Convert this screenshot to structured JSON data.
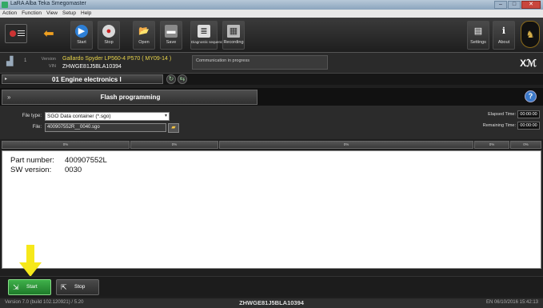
{
  "window": {
    "title": "LaRA  Alba Teka  Smegomaster"
  },
  "menu": [
    "Action",
    "Function",
    "View",
    "Setup",
    "Help"
  ],
  "toolbar": {
    "start": "Start",
    "stop": "Stop",
    "open": "Open",
    "save": "Save",
    "diagnostic": "Diagnostic sequences",
    "recording": "Recording",
    "settings": "Settings",
    "about": "About"
  },
  "vehicle": {
    "index": "1",
    "version_label": "Version",
    "vin_label": "VIN",
    "model": "Gallardo Spyder LP560-4 P570 ( MY09-14 )",
    "vin": "ZHWGE81J5BLA10394",
    "communication": "Communication in progress"
  },
  "module": {
    "name": "01 Engine electronics I"
  },
  "section": {
    "title": "Flash programming"
  },
  "file": {
    "type_label": "File type:",
    "type_value": "SGO Data container (*.sgo)",
    "file_label": "File:",
    "file_value": "400907552R__0040.sgo",
    "elapsed_label": "Elapsed Time:",
    "elapsed_value": "00:00:00",
    "remaining_label": "Remaining Time:",
    "remaining_value": "00:00:00"
  },
  "progress_headers": [
    "0%",
    "0%",
    "0%",
    "0%",
    "0%"
  ],
  "output": {
    "part_label": "Part number:",
    "part_value": "400907552L",
    "sw_label": "SW version:",
    "sw_value": "0030"
  },
  "bottom": {
    "start": "Start",
    "stop": "Stop"
  },
  "status": {
    "version": "Version 7.0 (build 102.120921) / 5.20",
    "vin": "ZHWGE81J5BLA10394",
    "locale_time": "EN 06/10/2016 15:42:13"
  }
}
